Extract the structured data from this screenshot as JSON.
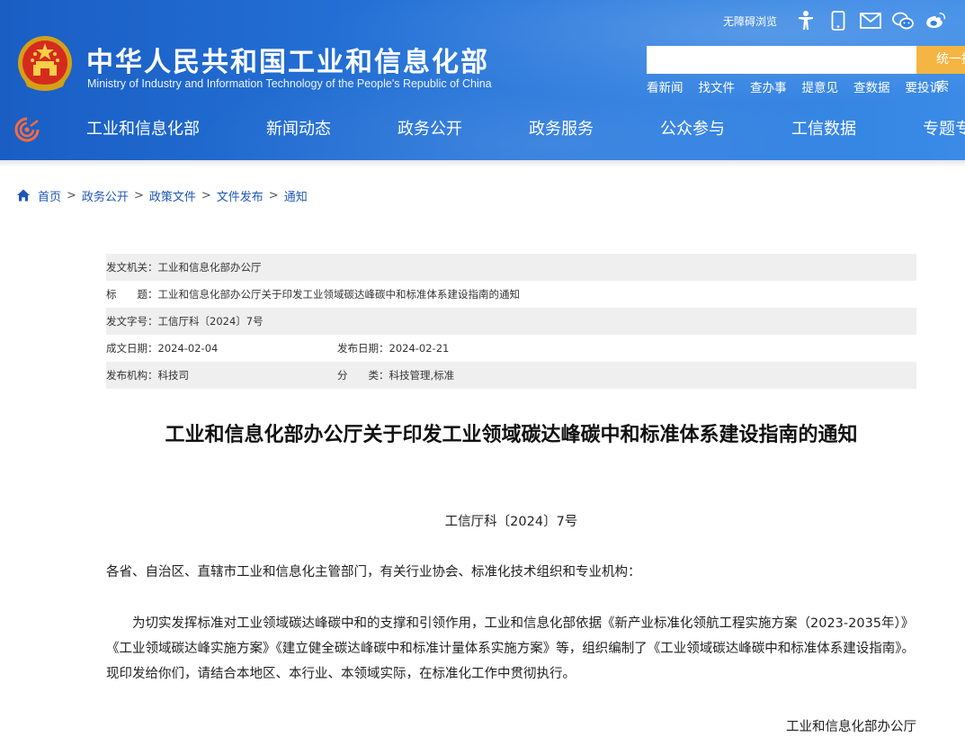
{
  "header": {
    "title_cn": "中华人民共和国工业和信息化部",
    "title_en": "Ministry of Industry and Information Technology of the People's Republic of China",
    "barrier_free": "无障碍浏览",
    "search": {
      "value": "",
      "button_label": "统一搜索"
    },
    "quick_links": [
      "看新闻",
      "找文件",
      "查办事",
      "提意见",
      "查数据",
      "要投诉"
    ],
    "nav": [
      "工业和信息化部",
      "新闻动态",
      "政务公开",
      "政务服务",
      "公众参与",
      "工信数据",
      "专题专栏"
    ],
    "colors": {
      "primary": "#2471d6",
      "accent": "#f5b542"
    }
  },
  "breadcrumb": [
    "首页",
    "政务公开",
    "政策文件",
    "文件发布",
    "通知"
  ],
  "meta": {
    "issuer_label": "发文机关：",
    "issuer": "工业和信息化部办公厅",
    "title_label": "标　　题：",
    "title": "工业和信息化部办公厅关于印发工业领域碳达峰碳中和标准体系建设指南的通知",
    "docno_label": "发文字号：",
    "docno": "工信厅科〔2024〕7号",
    "created_label": "成文日期：",
    "created": "2024-02-04",
    "published_label": "发布日期：",
    "published": "2024-02-21",
    "org_label": "发布机构：",
    "org": "科技司",
    "category_label": "分　　类：",
    "category": "科技管理,标准"
  },
  "article": {
    "title": "工业和信息化部办公厅关于印发工业领域碳达峰碳中和标准体系建设指南的通知",
    "doc_no": "工信厅科〔2024〕7号",
    "salutation": "各省、自治区、直辖市工业和信息化主管部门，有关行业协会、标准化技术组织和专业机构：",
    "body": "为切实发挥标准对工业领域碳达峰碳中和的支撑和引领作用，工业和信息化部依据《新产业标准化领航工程实施方案（2023-2035年）》《工业领域碳达峰实施方案》《建立健全碳达峰碳中和标准计量体系实施方案》等，组织编制了《工业领域碳达峰碳中和标准体系建设指南》。现印发给你们，请结合本地区、本行业、本领域实际，在标准化工作中贯彻执行。",
    "signature": "工业和信息化部办公厅"
  }
}
